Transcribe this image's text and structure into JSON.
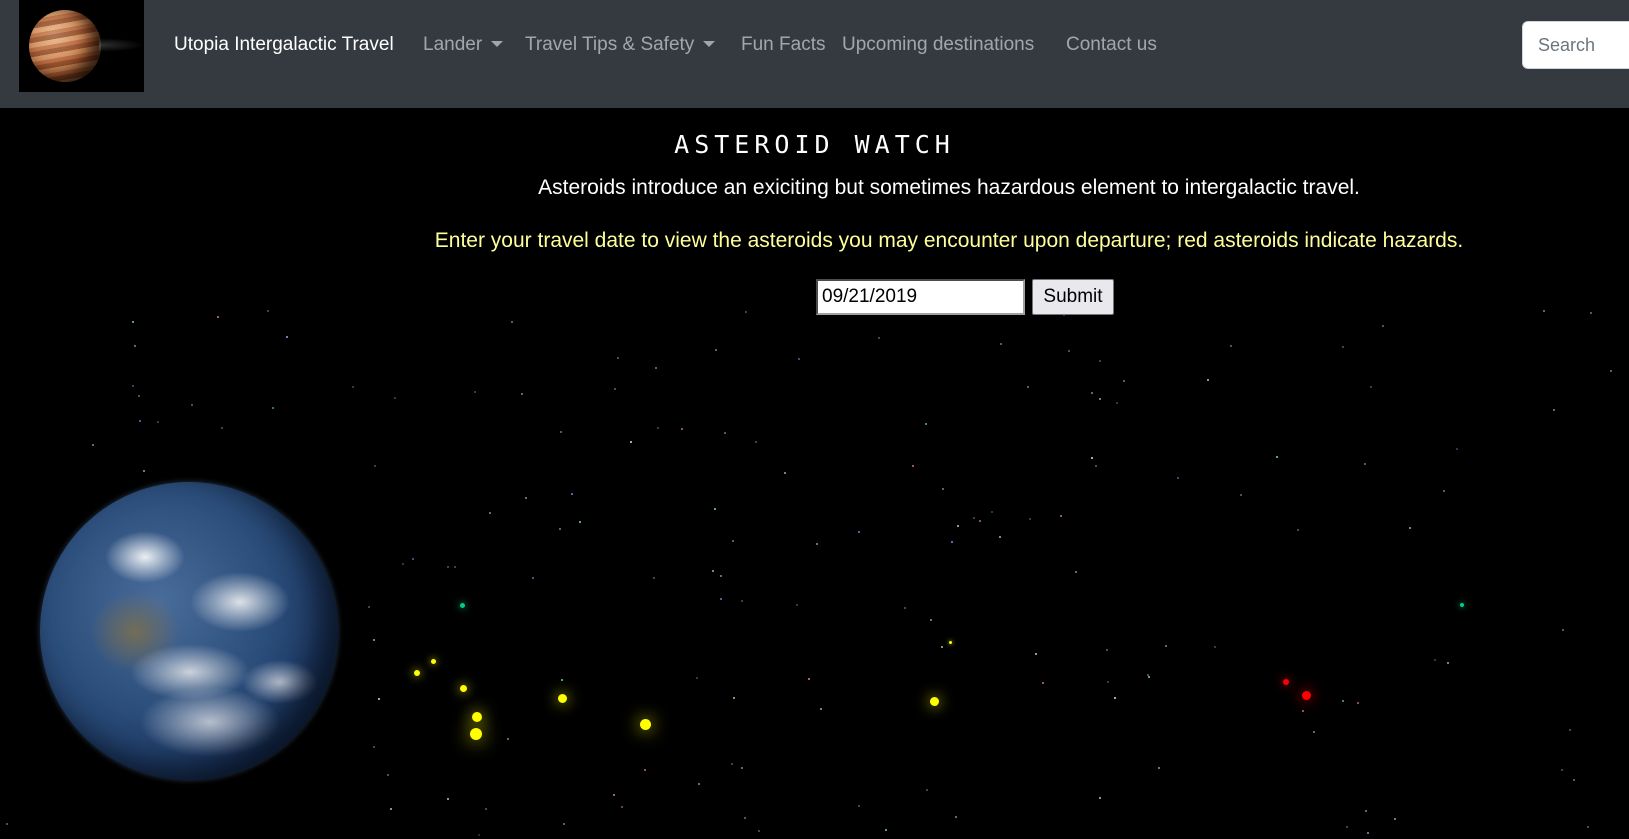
{
  "navbar": {
    "brand": "Utopia Intergalactic Travel",
    "items": [
      {
        "label": "Lander",
        "dropdown": true
      },
      {
        "label": "Travel Tips & Safety",
        "dropdown": true
      },
      {
        "label": "Fun Facts",
        "dropdown": false
      },
      {
        "label": "Upcoming destinations",
        "dropdown": false
      },
      {
        "label": "Contact us",
        "dropdown": false
      }
    ],
    "search_placeholder": "Search"
  },
  "main": {
    "title": "Asteroid Watch",
    "intro": "Asteroids introduce an exiciting but sometimes hazardous element to intergalactic travel.",
    "instructions": "Enter your travel date to view the asteroids you may encounter upon departure; red asteroids indicate hazards.",
    "date_value": "09/21/2019",
    "submit_label": "Submit"
  },
  "colors": {
    "navbar_bg": "#343a40",
    "instructions_text": "#ffff99",
    "asteroid_safe": "#ffff00",
    "asteroid_hazard": "#ff0000"
  }
}
